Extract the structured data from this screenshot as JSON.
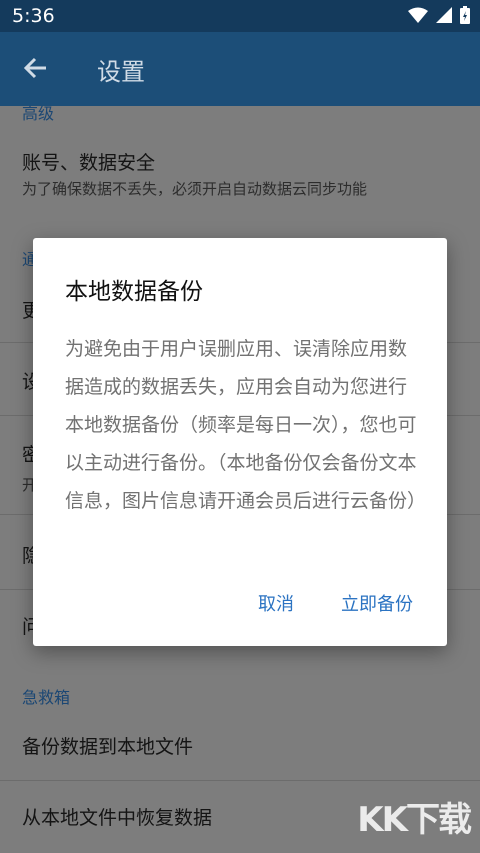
{
  "status_bar": {
    "time": "5:36"
  },
  "app_bar": {
    "title": "设置"
  },
  "sections": {
    "advanced": "高级",
    "general_partial": "通",
    "first_aid": "急救箱"
  },
  "items": {
    "account": {
      "title": "账号、数据安全",
      "subtitle": "为了确保数据不丢失，必须开启自动数据云同步功能"
    },
    "partial_1": "更",
    "partial_2": "设",
    "partial_3_title": "密",
    "partial_3_sub": "开",
    "partial_4": "隐",
    "partial_5": "问",
    "backup_to_file": "备份数据到本地文件",
    "restore_from_file": "从本地文件中恢复数据"
  },
  "dialog": {
    "title": "本地数据备份",
    "body": "为避免由于用户误删应用、误清除应用数据造成的数据丢失，应用会自动为您进行本地数据备份（频率是每日一次），您也可以主动进行备份。（本地备份仅会备份文本信息，图片信息请开通会员后进行云备份）",
    "cancel": "取消",
    "confirm": "立即备份"
  },
  "watermark": "KK下载",
  "colors": {
    "accent": "#2b73c2",
    "app_bar": "#1c4e78",
    "status_bar": "#143a5c"
  }
}
